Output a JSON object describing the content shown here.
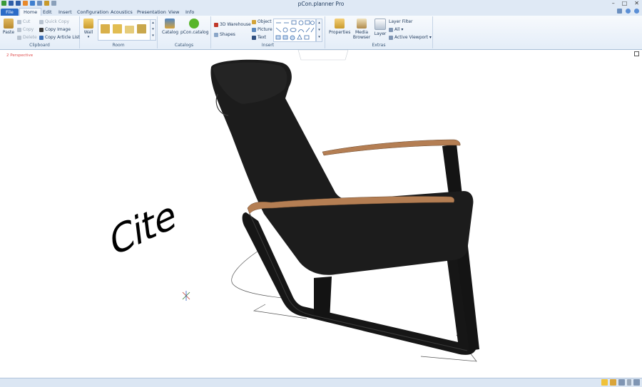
{
  "window": {
    "title": "pCon.planner Pro"
  },
  "tabs": {
    "file": "File",
    "home": "Home",
    "edit": "Edit",
    "insert": "Insert",
    "configuration": "Configuration",
    "acoustics": "Acoustics",
    "presentation": "Presentation",
    "view": "View",
    "info": "Info"
  },
  "ribbon": {
    "clipboard": {
      "label": "Clipboard",
      "paste": "Paste",
      "cut": "Cut",
      "copy": "Copy",
      "delete": "Delete",
      "quick_copy": "Quick Copy",
      "copy_image": "Copy Image",
      "copy_article_list": "Copy Article List"
    },
    "room": {
      "label": "Room",
      "wall": "Wall"
    },
    "catalogs": {
      "label": "Catalogs",
      "catalog": "Catalog",
      "pcon_catalog": "pCon.catalog"
    },
    "insert": {
      "label": "Insert",
      "warehouse": "3D Warehouse",
      "shapes": "Shapes",
      "object": "Object",
      "picture": "Picture",
      "text": "Text"
    },
    "extras": {
      "label": "Extras",
      "properties": "Properties",
      "media_browser": "Media Browser",
      "layer": "Layer",
      "layer_filter": "Layer Filter",
      "all": "All",
      "active_viewport": "Active Viewport"
    }
  },
  "viewport": {
    "label": "2 Perspective",
    "floor_text": "Cite"
  },
  "colors": {
    "accent": "#2b6bc7",
    "ribbon_bg": "#e4edf8",
    "chair": "#1c1c1c",
    "armrest": "#b47e53",
    "label_red": "#e05050"
  }
}
